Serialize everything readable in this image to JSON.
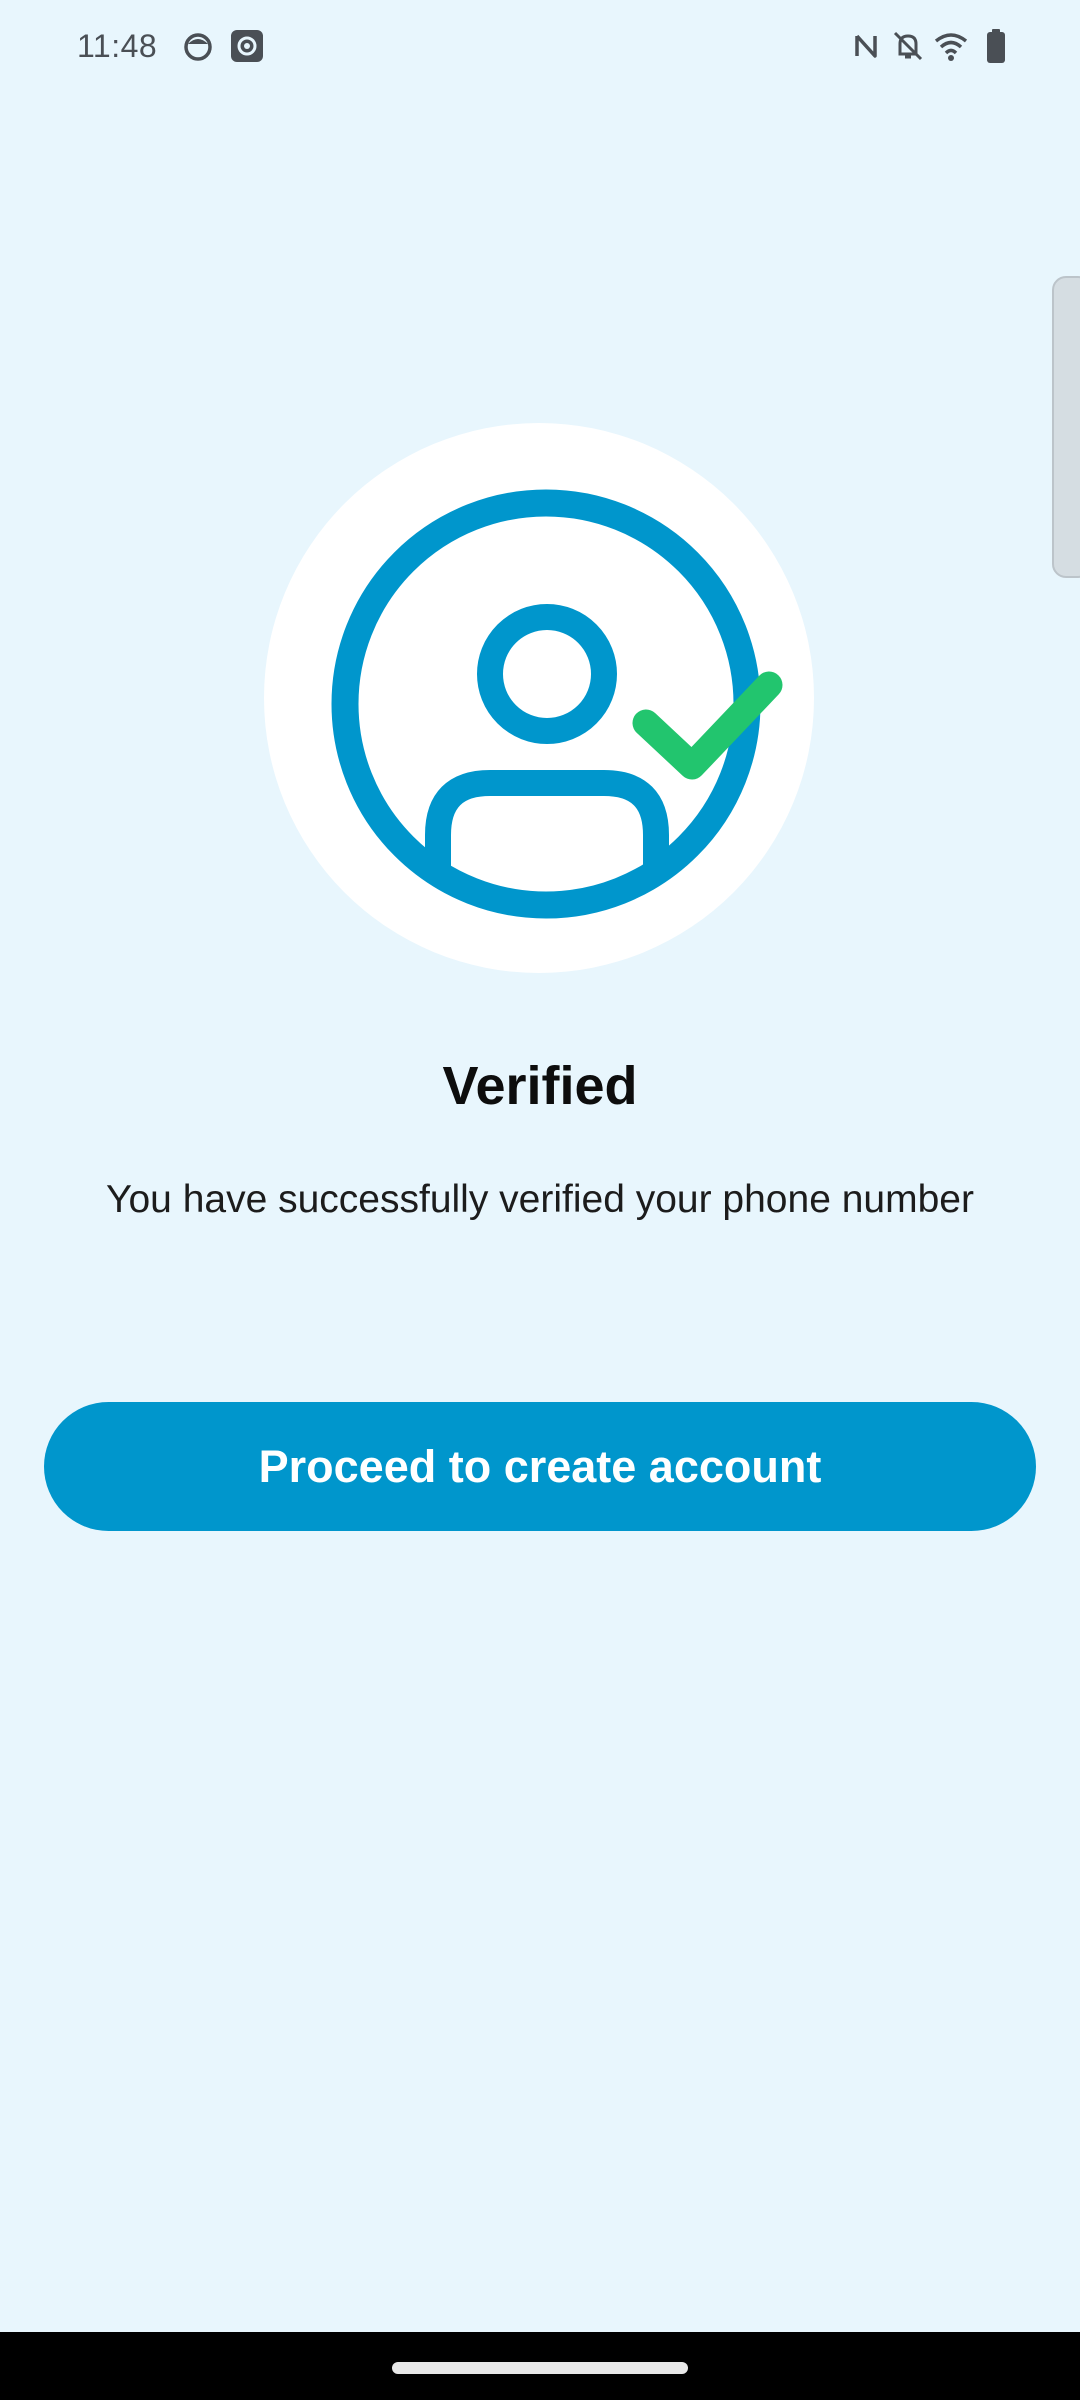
{
  "status_bar": {
    "time": "11:48",
    "left_icons": [
      "cat-face-icon",
      "settings-icon"
    ],
    "right_icons": [
      "nfc-icon",
      "bell-off-icon",
      "wifi-icon",
      "battery-icon"
    ]
  },
  "main": {
    "illustration": "verified-user-icon",
    "title": "Verified",
    "message": "You have successfully verified your phone number",
    "proceed_label": "Proceed to create account"
  },
  "colors": {
    "background": "#E8F6FD",
    "primary": "#0096CC",
    "check": "#22C56E",
    "button_text": "#FFFFFF"
  }
}
